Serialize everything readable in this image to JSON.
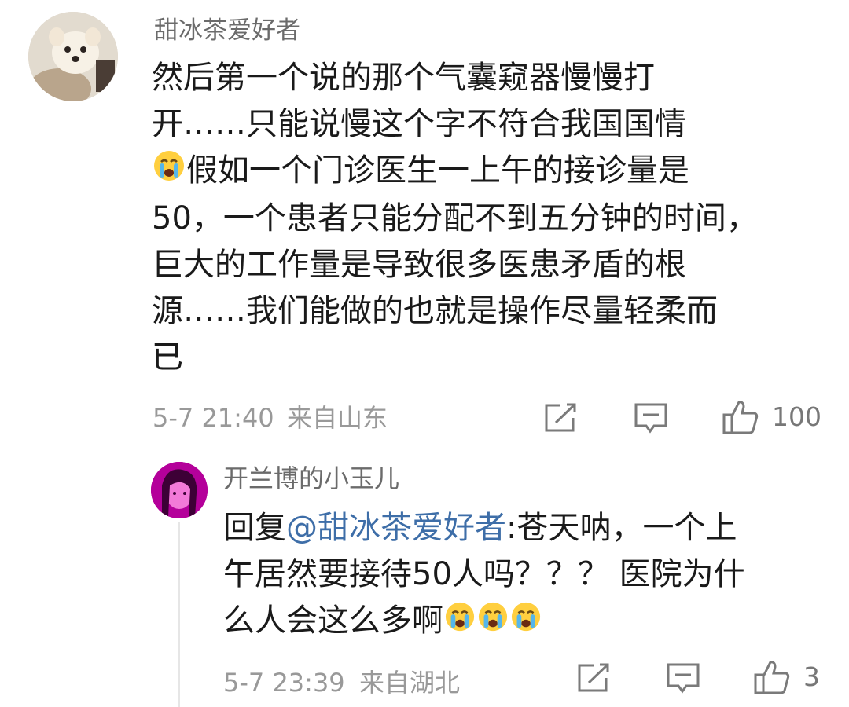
{
  "comments": [
    {
      "username": "甜冰茶爱好者",
      "avatar_icon": "pomeranian-dog-avatar",
      "lines": [
        "然后第一个说的那个气囊窥器慢慢打",
        "开……只能说慢这个字不符合我国国情",
        "假如一个门诊医生一上午的接诊量是",
        "50，一个患者只能分配不到五分钟的时间，",
        "巨大的工作量是导致很多医患矛盾的根",
        "源……我们能做的也就是操作尽量轻柔而",
        "已"
      ],
      "emoji": "crying-face-emoji",
      "time": "5-7 21:40",
      "location": "来自山东",
      "likes": "100"
    },
    {
      "username": "开兰博的小玉儿",
      "avatar_icon": "girl-pink-avatar",
      "reply_prefix": "回复",
      "mention": "@甜冰茶爱好者",
      "lines": [
        ":苍天呐，一个上",
        "午居然要接待50人吗？？？ 医院为什",
        "么人会这么多啊"
      ],
      "emoji": "crying-face-emoji",
      "time": "5-7 23:39",
      "location": "来自湖北",
      "likes": "3"
    }
  ],
  "colors": {
    "mention": "#3e6ea8",
    "meta": "#999999",
    "username": "#6b6b6b"
  }
}
